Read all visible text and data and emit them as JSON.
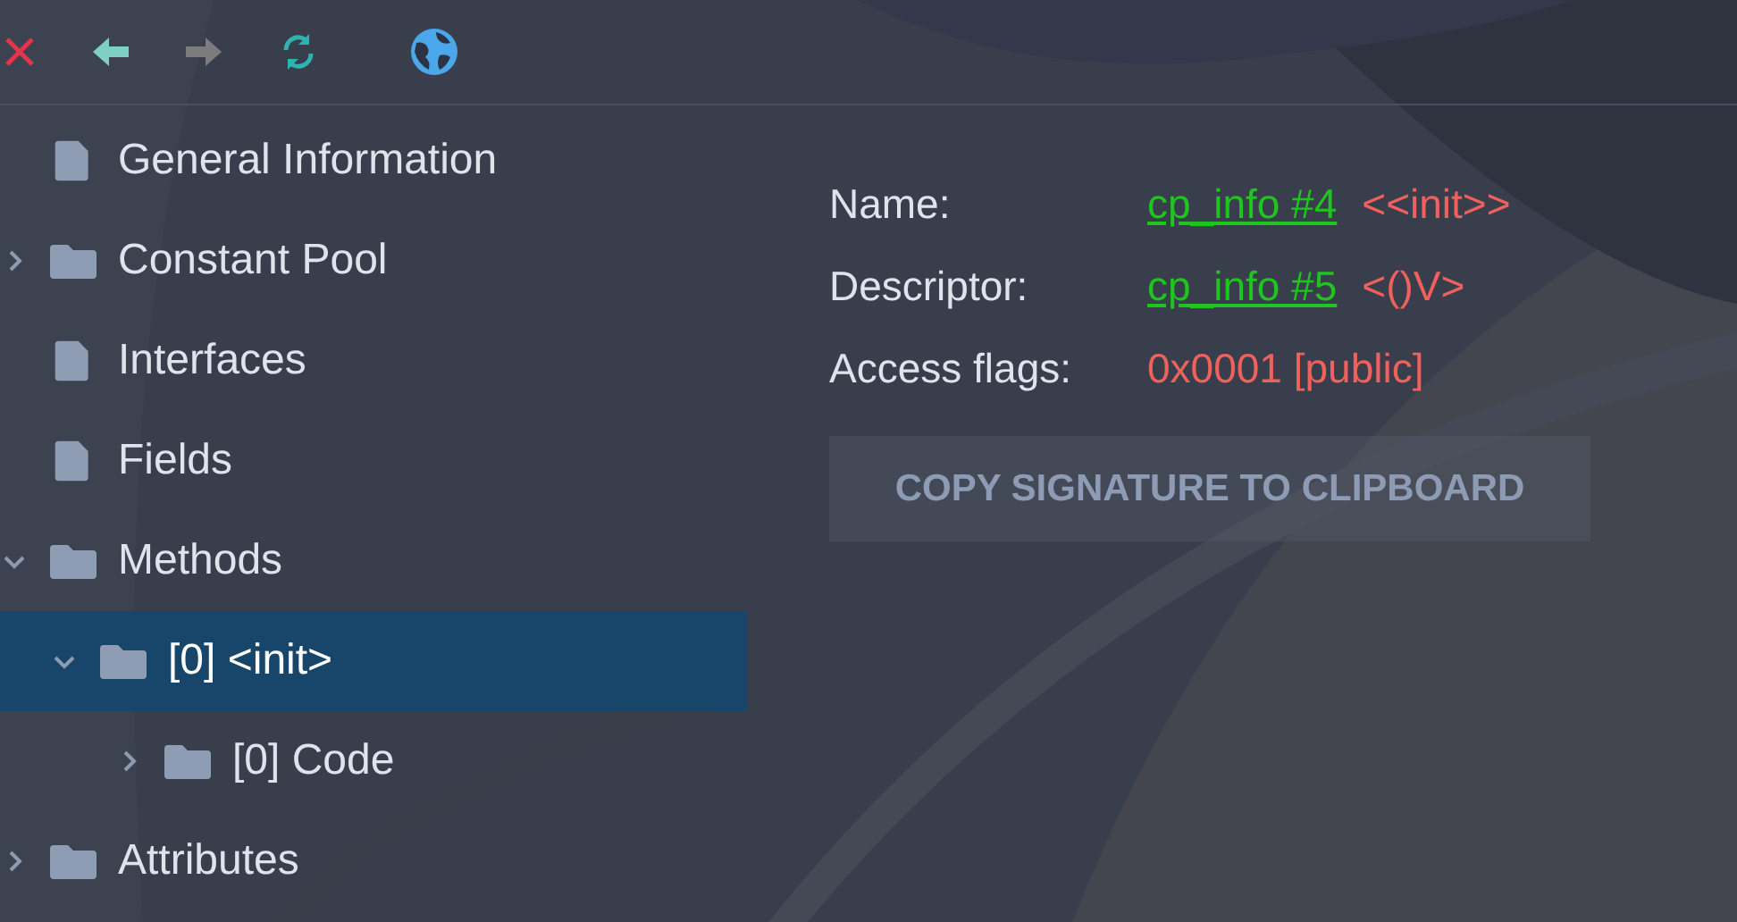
{
  "toolbar": [
    {
      "kind": "close",
      "disabled": false
    },
    {
      "kind": "back",
      "disabled": false
    },
    {
      "kind": "forward",
      "disabled": true
    },
    {
      "kind": "refresh",
      "disabled": false
    },
    {
      "kind": "web",
      "disabled": false
    }
  ],
  "tree": [
    {
      "kind": "file",
      "label": "General Information",
      "selected": false
    },
    {
      "kind": "folder",
      "label": "Constant Pool",
      "expanded": false,
      "selected": false
    },
    {
      "kind": "file",
      "label": "Interfaces",
      "selected": false
    },
    {
      "kind": "file",
      "label": "Fields",
      "selected": false
    },
    {
      "kind": "folder",
      "label": "Methods",
      "expanded": true,
      "selected": false,
      "children": [
        {
          "kind": "folder",
          "label": "[0] <init>",
          "expanded": true,
          "selected": true,
          "children": [
            {
              "kind": "folder",
              "label": "[0] Code",
              "expanded": false,
              "selected": false
            }
          ]
        }
      ]
    },
    {
      "kind": "folder",
      "label": "Attributes",
      "expanded": false,
      "selected": false
    }
  ],
  "details": [
    {
      "label": "Name:",
      "link": "cp_info #4",
      "value": "<<init>>"
    },
    {
      "label": "Descriptor:",
      "link": "cp_info #5",
      "value": "<()V>"
    },
    {
      "label": "Access flags:",
      "value": "0x0001 [public]"
    }
  ],
  "copy_button": "COPY SIGNATURE TO CLIPBOARD"
}
